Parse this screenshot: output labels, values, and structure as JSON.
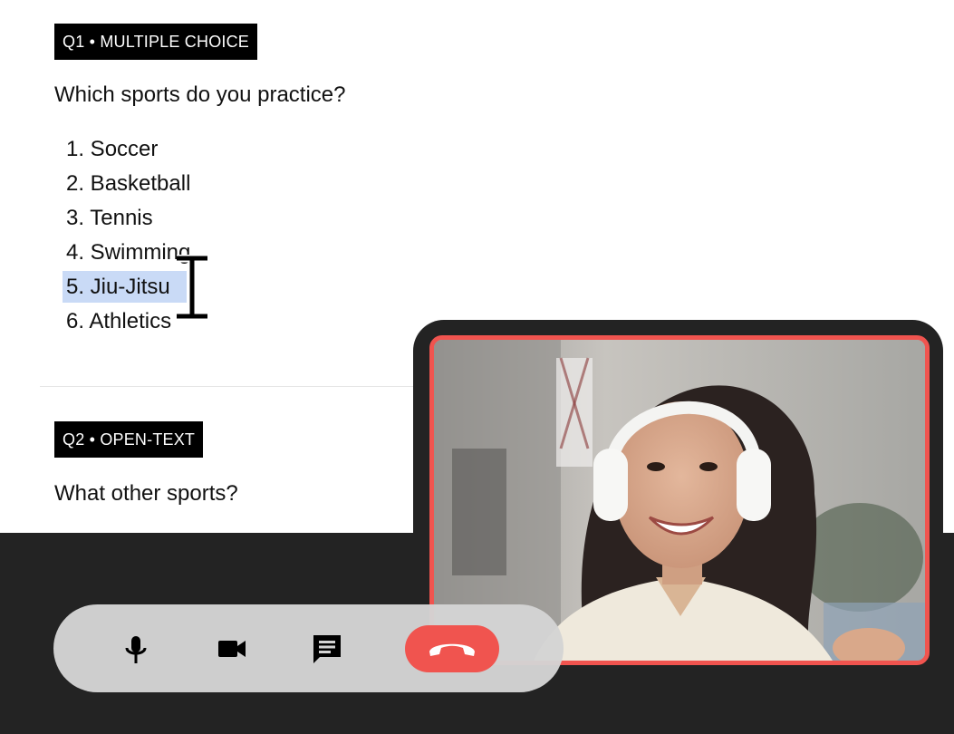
{
  "survey": {
    "q1": {
      "tag": "Q1 • MULTIPLE CHOICE",
      "text": "Which sports do you practice?",
      "options": [
        "1. Soccer",
        "2. Basketball",
        "3. Tennis",
        "4. Swimming",
        "5. Jiu-Jitsu",
        "6. Athletics"
      ],
      "selected_option": "5. Jiu-Jitsu"
    },
    "q2": {
      "tag": "Q2 • OPEN-TEXT",
      "text": "What other sports?"
    }
  },
  "call_controls": {
    "icons": [
      "microphone-icon",
      "video-camera-icon",
      "chat-icon",
      "end-call-icon"
    ],
    "end_call_color": "#f0544f"
  },
  "video": {
    "border_color": "#f0544f"
  }
}
